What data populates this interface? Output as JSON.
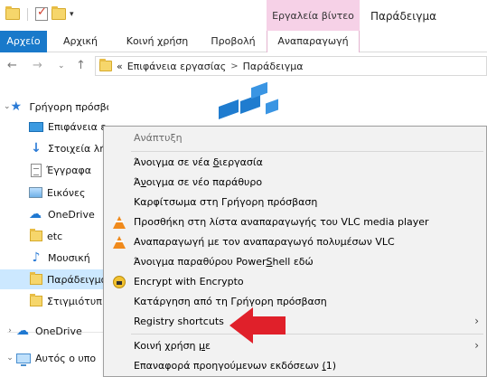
{
  "titlebar": {
    "context_tab_label": "Εργαλεία βίντεο",
    "window_title": "Παράδειγμα",
    "qat_icons": [
      "folder-icon",
      "properties-check-icon",
      "new-folder-icon",
      "customize-dropdown-icon"
    ]
  },
  "ribbon": {
    "tabs": [
      {
        "label": "Αρχείο"
      },
      {
        "label": "Αρχική"
      },
      {
        "label": "Κοινή χρήση"
      },
      {
        "label": "Προβολή"
      },
      {
        "label": "Αναπαραγωγή"
      }
    ]
  },
  "address": {
    "path": [
      "Επιφάνεια εργασίας",
      "Παράδειγμα"
    ],
    "overflow": "«",
    "sep": ">"
  },
  "navpane": {
    "items": [
      {
        "label": "Γρήγορη πρόσβαση",
        "icon": "star-icon"
      },
      {
        "label": "Επιφάνεια ε",
        "icon": "desktop-icon"
      },
      {
        "label": "Στοιχεία λή",
        "icon": "download-icon"
      },
      {
        "label": "Έγγραφα",
        "icon": "documents-icon"
      },
      {
        "label": "Εικόνες",
        "icon": "pictures-icon"
      },
      {
        "label": "OneDrive",
        "icon": "onedrive-icon"
      },
      {
        "label": "etc",
        "icon": "folder-icon"
      },
      {
        "label": "Μουσική",
        "icon": "music-icon"
      },
      {
        "label": "Παράδειγμα",
        "icon": "folder-icon"
      },
      {
        "label": "Στιγμιότυπ",
        "icon": "folder-icon"
      },
      {
        "label": "OneDrive",
        "icon": "onedrive-icon"
      },
      {
        "label": "Αυτός ο υπο",
        "icon": "computer-icon"
      }
    ]
  },
  "context_menu": {
    "items": [
      {
        "label": "Ανάπτυξη",
        "disabled": true
      },
      {
        "pre": "Άνοιγμα σε νέα ",
        "u": "δ",
        "post": "ιεργασία"
      },
      {
        "pre": "Ά",
        "u": "ν",
        "post": "οιγμα σε νέο παράθυρο"
      },
      {
        "pre": "Καρφίτσωμα στη Γρήγορη πρόσβαση",
        "u": "",
        "post": ""
      },
      {
        "pre": "Προσθήκη στη λίστα αναπαραγωγής του VLC media player",
        "u": "",
        "post": "",
        "icon": "vlc-icon"
      },
      {
        "pre": "Αναπαραγωγή με τον αναπαραγωγό πολυμέσων VLC",
        "u": "",
        "post": "",
        "icon": "vlc-icon"
      },
      {
        "pre": "Άνοιγμα παραθύρου Power",
        "u": "S",
        "post": "hell εδώ"
      },
      {
        "pre": "Encrypt with Encrypto",
        "u": "",
        "post": "",
        "icon": "encrypto-icon"
      },
      {
        "pre": "Κατάργηση από τη Γρήγορη πρόσβαση",
        "u": "",
        "post": ""
      },
      {
        "pre": "Registry shortcuts",
        "u": "",
        "post": "",
        "submenu": true
      },
      {
        "pre": "Κοινή χρήση ",
        "u": "μ",
        "post": "ε",
        "submenu": true
      },
      {
        "pre": "Επαναφορά προηγούμενων εκδόσεων ",
        "u": "(",
        "post": "1)"
      }
    ]
  },
  "colors": {
    "file_tab": "#1979ca",
    "context_tab": "#f6d1e7",
    "selection": "#cce8ff",
    "annotation_arrow": "#e0202a"
  }
}
